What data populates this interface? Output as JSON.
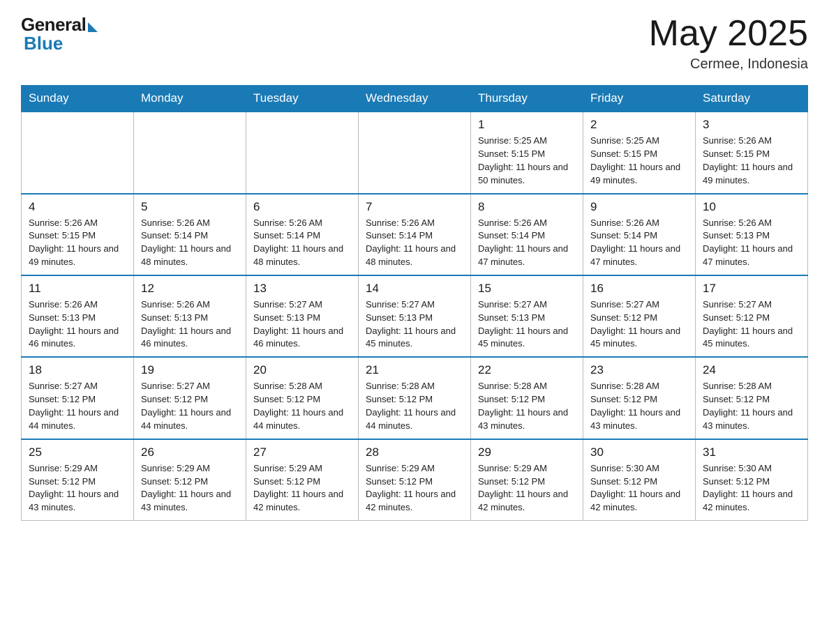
{
  "header": {
    "logo_general": "General",
    "logo_blue": "Blue",
    "month_title": "May 2025",
    "location": "Cermee, Indonesia"
  },
  "days_of_week": [
    "Sunday",
    "Monday",
    "Tuesday",
    "Wednesday",
    "Thursday",
    "Friday",
    "Saturday"
  ],
  "weeks": [
    [
      {
        "day": "",
        "info": ""
      },
      {
        "day": "",
        "info": ""
      },
      {
        "day": "",
        "info": ""
      },
      {
        "day": "",
        "info": ""
      },
      {
        "day": "1",
        "info": "Sunrise: 5:25 AM\nSunset: 5:15 PM\nDaylight: 11 hours\nand 50 minutes."
      },
      {
        "day": "2",
        "info": "Sunrise: 5:25 AM\nSunset: 5:15 PM\nDaylight: 11 hours\nand 49 minutes."
      },
      {
        "day": "3",
        "info": "Sunrise: 5:26 AM\nSunset: 5:15 PM\nDaylight: 11 hours\nand 49 minutes."
      }
    ],
    [
      {
        "day": "4",
        "info": "Sunrise: 5:26 AM\nSunset: 5:15 PM\nDaylight: 11 hours\nand 49 minutes."
      },
      {
        "day": "5",
        "info": "Sunrise: 5:26 AM\nSunset: 5:14 PM\nDaylight: 11 hours\nand 48 minutes."
      },
      {
        "day": "6",
        "info": "Sunrise: 5:26 AM\nSunset: 5:14 PM\nDaylight: 11 hours\nand 48 minutes."
      },
      {
        "day": "7",
        "info": "Sunrise: 5:26 AM\nSunset: 5:14 PM\nDaylight: 11 hours\nand 48 minutes."
      },
      {
        "day": "8",
        "info": "Sunrise: 5:26 AM\nSunset: 5:14 PM\nDaylight: 11 hours\nand 47 minutes."
      },
      {
        "day": "9",
        "info": "Sunrise: 5:26 AM\nSunset: 5:14 PM\nDaylight: 11 hours\nand 47 minutes."
      },
      {
        "day": "10",
        "info": "Sunrise: 5:26 AM\nSunset: 5:13 PM\nDaylight: 11 hours\nand 47 minutes."
      }
    ],
    [
      {
        "day": "11",
        "info": "Sunrise: 5:26 AM\nSunset: 5:13 PM\nDaylight: 11 hours\nand 46 minutes."
      },
      {
        "day": "12",
        "info": "Sunrise: 5:26 AM\nSunset: 5:13 PM\nDaylight: 11 hours\nand 46 minutes."
      },
      {
        "day": "13",
        "info": "Sunrise: 5:27 AM\nSunset: 5:13 PM\nDaylight: 11 hours\nand 46 minutes."
      },
      {
        "day": "14",
        "info": "Sunrise: 5:27 AM\nSunset: 5:13 PM\nDaylight: 11 hours\nand 45 minutes."
      },
      {
        "day": "15",
        "info": "Sunrise: 5:27 AM\nSunset: 5:13 PM\nDaylight: 11 hours\nand 45 minutes."
      },
      {
        "day": "16",
        "info": "Sunrise: 5:27 AM\nSunset: 5:12 PM\nDaylight: 11 hours\nand 45 minutes."
      },
      {
        "day": "17",
        "info": "Sunrise: 5:27 AM\nSunset: 5:12 PM\nDaylight: 11 hours\nand 45 minutes."
      }
    ],
    [
      {
        "day": "18",
        "info": "Sunrise: 5:27 AM\nSunset: 5:12 PM\nDaylight: 11 hours\nand 44 minutes."
      },
      {
        "day": "19",
        "info": "Sunrise: 5:27 AM\nSunset: 5:12 PM\nDaylight: 11 hours\nand 44 minutes."
      },
      {
        "day": "20",
        "info": "Sunrise: 5:28 AM\nSunset: 5:12 PM\nDaylight: 11 hours\nand 44 minutes."
      },
      {
        "day": "21",
        "info": "Sunrise: 5:28 AM\nSunset: 5:12 PM\nDaylight: 11 hours\nand 44 minutes."
      },
      {
        "day": "22",
        "info": "Sunrise: 5:28 AM\nSunset: 5:12 PM\nDaylight: 11 hours\nand 43 minutes."
      },
      {
        "day": "23",
        "info": "Sunrise: 5:28 AM\nSunset: 5:12 PM\nDaylight: 11 hours\nand 43 minutes."
      },
      {
        "day": "24",
        "info": "Sunrise: 5:28 AM\nSunset: 5:12 PM\nDaylight: 11 hours\nand 43 minutes."
      }
    ],
    [
      {
        "day": "25",
        "info": "Sunrise: 5:29 AM\nSunset: 5:12 PM\nDaylight: 11 hours\nand 43 minutes."
      },
      {
        "day": "26",
        "info": "Sunrise: 5:29 AM\nSunset: 5:12 PM\nDaylight: 11 hours\nand 43 minutes."
      },
      {
        "day": "27",
        "info": "Sunrise: 5:29 AM\nSunset: 5:12 PM\nDaylight: 11 hours\nand 42 minutes."
      },
      {
        "day": "28",
        "info": "Sunrise: 5:29 AM\nSunset: 5:12 PM\nDaylight: 11 hours\nand 42 minutes."
      },
      {
        "day": "29",
        "info": "Sunrise: 5:29 AM\nSunset: 5:12 PM\nDaylight: 11 hours\nand 42 minutes."
      },
      {
        "day": "30",
        "info": "Sunrise: 5:30 AM\nSunset: 5:12 PM\nDaylight: 11 hours\nand 42 minutes."
      },
      {
        "day": "31",
        "info": "Sunrise: 5:30 AM\nSunset: 5:12 PM\nDaylight: 11 hours\nand 42 minutes."
      }
    ]
  ]
}
